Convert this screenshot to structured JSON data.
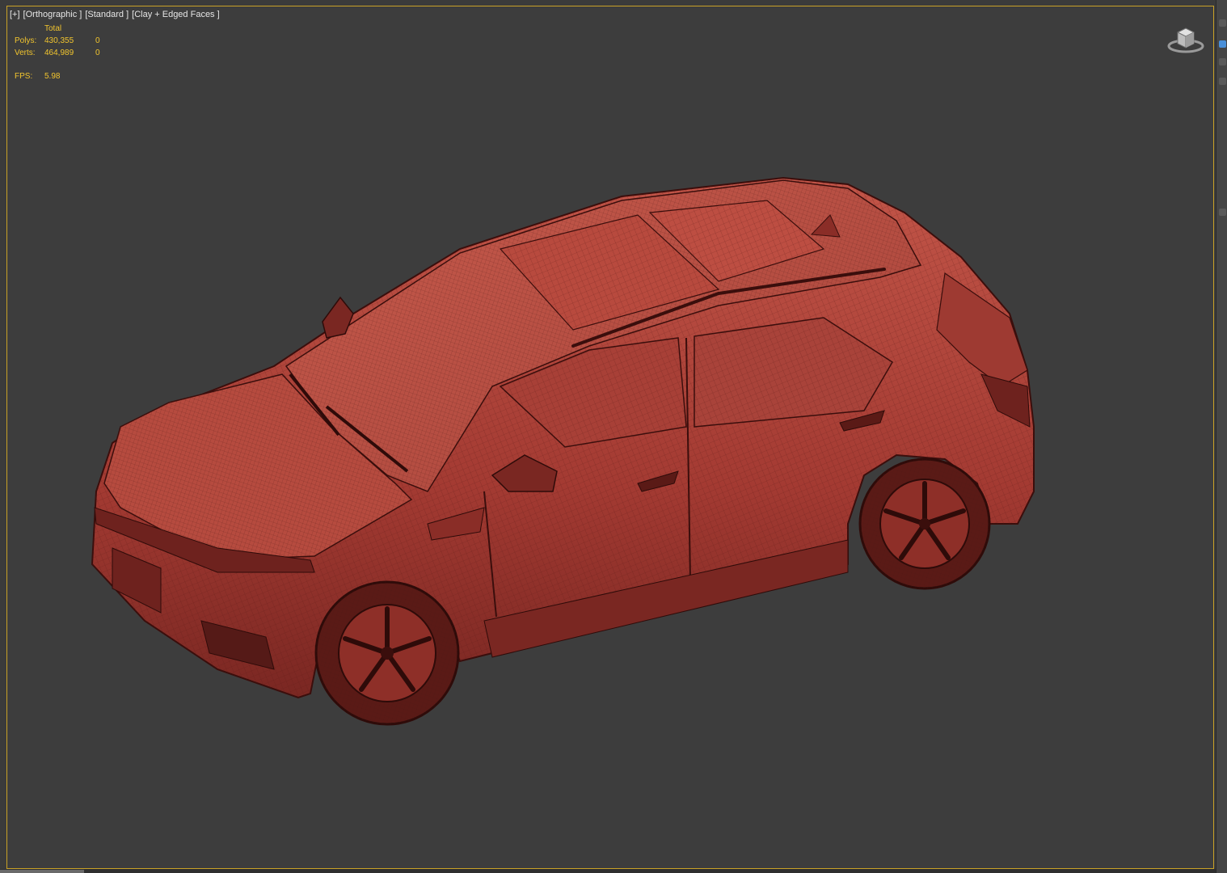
{
  "viewport": {
    "labels": [
      "[+]",
      "[Orthographic ]",
      "[Standard ]",
      "[Clay + Edged Faces ]"
    ],
    "stats": {
      "header": "Total",
      "polys_label": "Polys:",
      "polys_total": "430,355",
      "polys_selected": "0",
      "verts_label": "Verts:",
      "verts_total": "464,989",
      "verts_selected": "0",
      "fps_label": "FPS:",
      "fps_value": "5.98"
    }
  },
  "icons": {
    "viewcube": "viewcube-icon",
    "model": "car-wireframe-model"
  },
  "colors": {
    "background": "#3d3d3d",
    "model": "#b3463d",
    "stats_text": "#f2c52e",
    "active_border": "#c9a227"
  }
}
